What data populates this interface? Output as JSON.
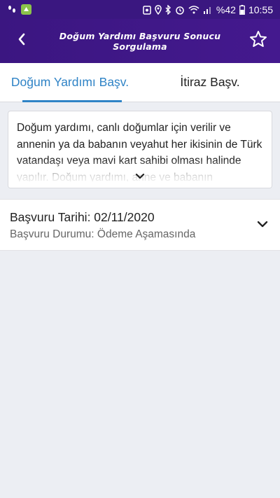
{
  "status_bar": {
    "battery_percent": "%42",
    "time": "10:55"
  },
  "app_bar": {
    "title": "Doğum Yardımı Başvuru Sonucu Sorgulama"
  },
  "tabs": [
    {
      "label": "Doğum Yardımı Başv."
    },
    {
      "label": "İtiraz Başv."
    }
  ],
  "info": {
    "text": "Doğum yardımı, canlı doğumlar için verilir ve annenin ya da babanın veyahut her ikisinin de Türk vatandaşı veya mavi kart sahibi olması halinde yapılır. Doğum yardımı, anne ve babanın"
  },
  "result": {
    "date_line": "Başvuru Tarihi: 02/11/2020",
    "status_line": "Başvuru Durumu: Ödeme Aşamasında"
  },
  "colors": {
    "header": "#3b1681",
    "accent": "#2f83c6",
    "background": "#eceef3"
  },
  "icons": {
    "back": "back-arrow-icon",
    "favorite": "star-outline-icon",
    "expand": "chevron-down-icon"
  }
}
